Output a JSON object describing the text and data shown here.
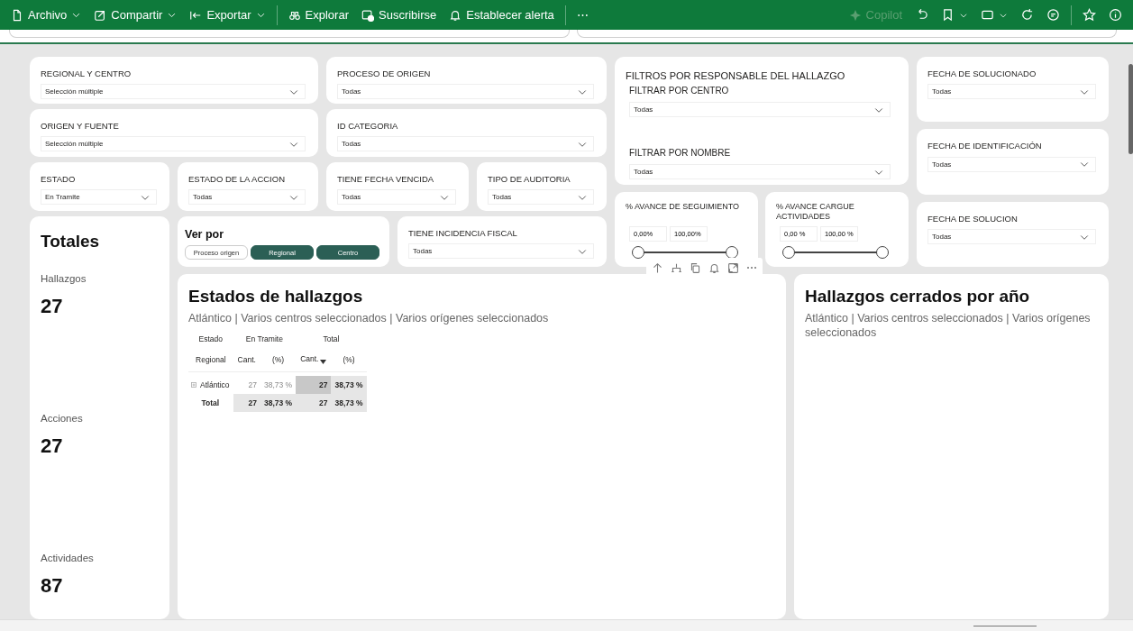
{
  "toolbar": {
    "items": [
      {
        "label": "Archivo",
        "dropdown": true
      },
      {
        "label": "Compartir",
        "dropdown": true
      },
      {
        "label": "Exportar",
        "dropdown": true
      },
      {
        "label": "Explorar",
        "dropdown": false
      },
      {
        "label": "Suscribirse",
        "dropdown": false
      },
      {
        "label": "Establecer alerta",
        "dropdown": false
      }
    ],
    "more": "⋯",
    "copilot": {
      "label": "Copilot",
      "disabled": true
    },
    "right": [
      {
        "dropdown": false
      },
      {
        "dropdown": true
      },
      {
        "dropdown": true
      },
      {
        "dropdown": false
      },
      {
        "dropdown": false
      },
      {
        "dropdown": false
      },
      {
        "dropdown": false
      }
    ]
  },
  "slicers": [
    {
      "label": "REGIONAL Y CENTRO",
      "value": "Selección múltiple"
    },
    {
      "label": "PROCESO DE ORIGEN",
      "value": "Todas"
    },
    {
      "label": "ORIGEN Y FUENTE",
      "value": "Selección múltiple"
    },
    {
      "label": "ID CATEGORIA",
      "value": "Todas"
    },
    {
      "label": "ESTADO",
      "value": "En Tramite"
    },
    {
      "label": "ESTADO DE LA ACCION",
      "value": "Todas"
    },
    {
      "label": "TIENE FECHA VENCIDA",
      "value": "Todas"
    },
    {
      "label": "TIPO DE AUDITORIA",
      "value": "Todas"
    }
  ],
  "responsable": {
    "title": "FILTROS POR RESPONSABLE DEL HALLAZGO",
    "filters": [
      {
        "label": "FILTRAR POR CENTRO",
        "value": "Todas"
      },
      {
        "label": "FILTRAR POR NOMBRE",
        "value": "Todas"
      }
    ]
  },
  "ranges": [
    {
      "label": "% AVANCE DE SEGUIMIENTO",
      "min": "0,00%",
      "max": "100,00%",
      "level": 1
    },
    {
      "label": "% AVANCE CARGUE ACTIVIDADES",
      "min": "0,00 %",
      "max": "100,00 %",
      "level": 1
    }
  ],
  "date_slicers": [
    {
      "label": "FECHA DE SOLUCIONADO",
      "value": "Todas"
    },
    {
      "label": "FECHA DE IDENTIFICACIÓN",
      "value": "Todas"
    },
    {
      "label": "FECHA DE SOLUCION",
      "value": "Todas"
    }
  ],
  "totales": {
    "title": "Totales",
    "metrics": [
      {
        "label": "Hallazgos",
        "value": "27"
      },
      {
        "label": "Acciones",
        "value": "27"
      },
      {
        "label": "Actividades",
        "value": "87"
      }
    ]
  },
  "ver_por": {
    "title": "Ver por",
    "options": [
      {
        "label": "Proceso origen",
        "selected": false
      },
      {
        "label": "Regional",
        "selected": true
      },
      {
        "label": "Centro",
        "selected": true
      }
    ]
  },
  "incidencia": {
    "label": "TIENE INCIDENCIA FISCAL",
    "value": "Todas"
  },
  "visual_header": {
    "more": "⋯"
  },
  "estados": {
    "title": "Estados de hallazgos",
    "subtitle": "Atlántico | Varios centros seleccionados | Varios orígenes seleccionados",
    "matrix": {
      "corner": [
        "Estado",
        "Regional"
      ],
      "groups": [
        {
          "label": "En Tramite",
          "columns": [
            {
              "label": "Cant.",
              "sorted": false
            },
            {
              "label": "(%)",
              "sorted": false
            }
          ]
        },
        {
          "label": "Total",
          "columns": [
            {
              "label": "Cant.",
              "sorted": true
            },
            {
              "label": "(%)",
              "sorted": false
            }
          ]
        }
      ],
      "rows": [
        {
          "label": "Atlántico",
          "expandable": true,
          "total": false,
          "cells": [
            "27",
            "38,73 %",
            "27",
            "38,73 %"
          ]
        },
        {
          "label": "Total",
          "expandable": false,
          "total": true,
          "cells": [
            "27",
            "38,73 %",
            "27",
            "38,73 %"
          ]
        }
      ]
    }
  },
  "cerrados": {
    "title": "Hallazgos cerrados por año",
    "subtitle": "Atlántico | Varios centros seleccionados | Varios orígenes seleccionados"
  }
}
